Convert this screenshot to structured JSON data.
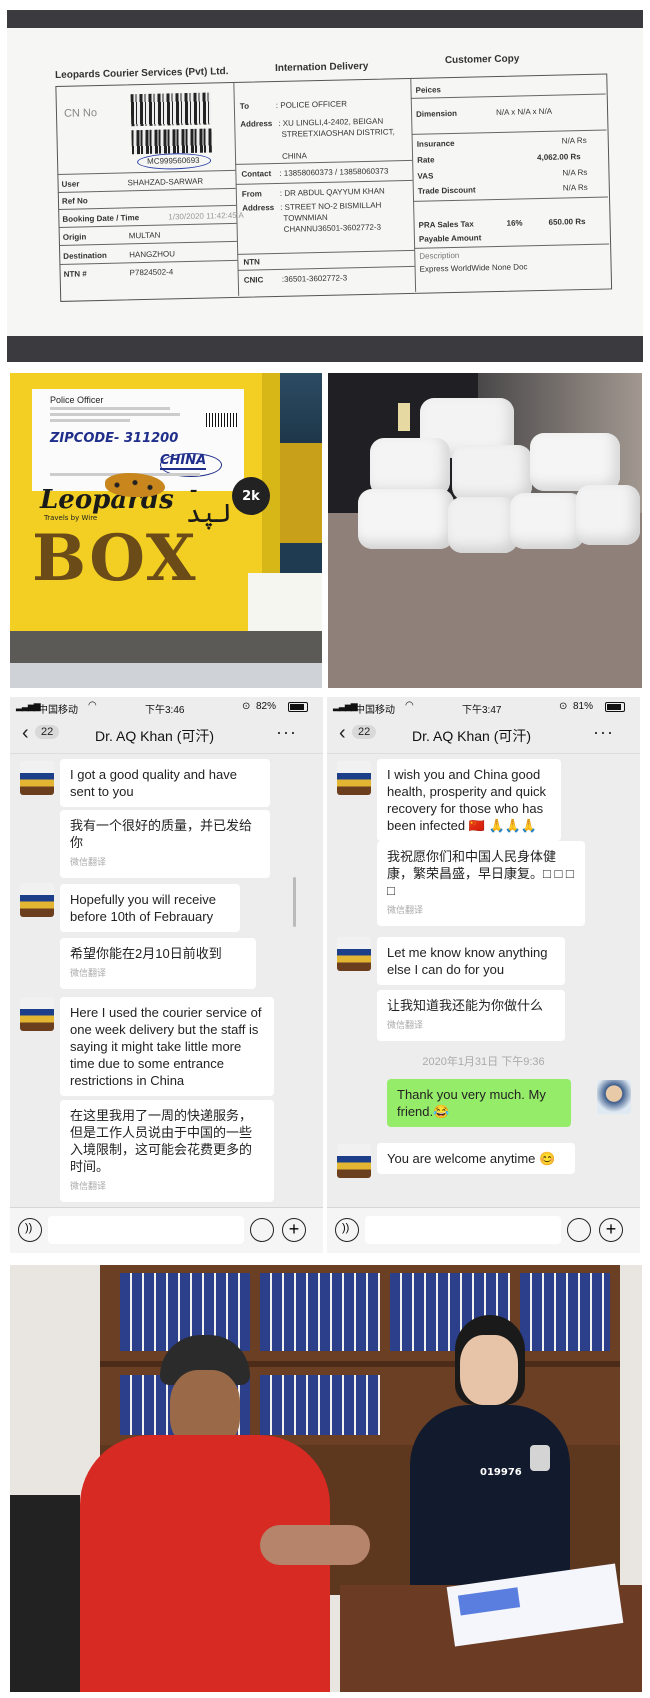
{
  "receipt": {
    "company": "Leopards Courier Services (Pvt) Ltd.",
    "center_title": "Internation Delivery",
    "copy_label": "Customer Copy",
    "cn_label": "CN No",
    "cn_number": "MC999560693",
    "user_label": "User",
    "user_value": "SHAHZAD-SARWAR",
    "ref_label": "Ref No",
    "booking_label": "Booking Date / Time",
    "booking_value": "1/30/2020 11:42:45 A",
    "origin_label": "Origin",
    "origin_value": "MULTAN",
    "destination_label": "Destination",
    "destination_value": "HANGZHOU",
    "ntn_label": "NTN #",
    "ntn_value": "P7824502-4",
    "to_label": "To",
    "to_value": ": POLICE OFFICER",
    "address_label": "Address",
    "address_value_1": ": XU LINGLI,4-2402, BEIGAN",
    "address_value_2": "STREETXIAOSHAN DISTRICT,",
    "china": "CHINA",
    "contact_label": "Contact",
    "contact_value": ": 13858060373 / 13858060373",
    "from_label": "From",
    "from_value": ": DR ABDUL QAYYUM KHAN",
    "from_addr_1": ": STREET NO-2 BISMILLAH",
    "from_addr_2": "TOWNMIAN",
    "from_addr_3": "CHANNU36501-3602772-3",
    "ntn2_label": "NTN",
    "cnic_label": "CNIC",
    "cnic_value": ":36501-3602772-3",
    "peices_label": "Peices",
    "dimension_label": "Dimension",
    "dimension_value": "N/A  x  N/A  x  N/A",
    "insurance_label": "Insurance",
    "insurance_value": "N/A Rs",
    "rate_label": "Rate",
    "rate_value": "4,062.00  Rs",
    "vas_label": "VAS",
    "vas_value": "N/A  Rs",
    "trade_label": "Trade Discount",
    "trade_value": "N/A  Rs",
    "pra_label": "PRA Sales Tax",
    "pra_pct": "16%",
    "pra_value": "650.00 Rs",
    "payable_label": "Payable Amount",
    "desc_label": "Description",
    "desc_value": "Express WorldWide None Doc"
  },
  "box_photo": {
    "label_title": "Police Officer",
    "handwriting": "ZIPCODE- 311200",
    "china_hand": "CHINA",
    "brand": "Leopards",
    "brand_sub": "Travels by Wire",
    "box_text": "BOX",
    "badge": "2k"
  },
  "chat_left": {
    "time": "下午3:46",
    "carrier": "中国移动",
    "battery": "82%",
    "back_count": "22",
    "title": "Dr. AQ Khan (可汗)",
    "messages": [
      {
        "text": "I got a good quality and have sent to you"
      },
      {
        "text": "我有一个很好的质量，并已发给你",
        "note": "微信翻译"
      },
      {
        "text": "Hopefully you will receive before 10th of Febrauary"
      },
      {
        "text": "希望你能在2月10日前收到",
        "note": "微信翻译"
      },
      {
        "text": "Here I used the courier service of one week delivery but the staff is saying it might take little more time due to some entrance restrictions in China"
      },
      {
        "text": "在这里我用了一周的快递服务，但是工作人员说由于中国的一些入境限制，这可能会花费更多的时间。",
        "note": "微信翻译"
      }
    ]
  },
  "chat_right": {
    "time": "下午3:47",
    "carrier": "中国移动",
    "battery": "81%",
    "back_count": "22",
    "title": "Dr. AQ Khan (可汗)",
    "messages": [
      {
        "text": "I wish you and China good health, prosperity and quick recovery for those who has been infected 🇨🇳 🙏🙏🙏"
      },
      {
        "text": "我祝愿你们和中国人民身体健康，繁荣昌盛，早日康复。□ □ □ □",
        "note": "微信翻译"
      },
      {
        "text": "Let me know know anything else I can do for you"
      },
      {
        "text": "让我知道我还能为你做什么",
        "note": "微信翻译"
      },
      {
        "timestamp": "2020年1月31日 下午9:36"
      },
      {
        "text": "Thank you very much. My friend.😂"
      },
      {
        "text": "You are welcome anytime 😊"
      }
    ]
  },
  "officer_photo": {
    "badge_number": "019976"
  }
}
